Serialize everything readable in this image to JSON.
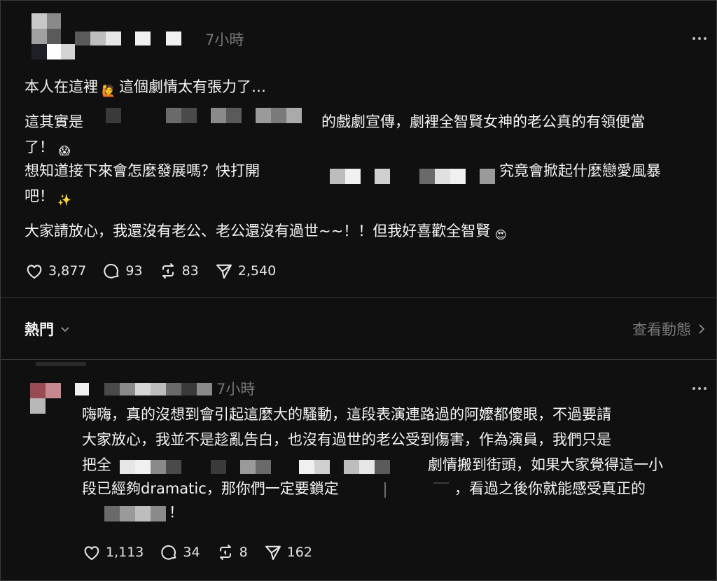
{
  "post": {
    "time": "7小時",
    "line1_text": "本人在這裡",
    "line1_text_b": "這個劇情太有張力了…",
    "line2_prefix": "這其實是",
    "line2_suffix": "的戲劇宣傳，劇裡全智賢女神的老公真的有領便當",
    "line3_text": "了！",
    "line4_prefix": "想知道接下來會怎麼發展嗎？快打開",
    "line4_suffix": "究竟會掀起什麼戀愛風暴",
    "line5_text": "吧！",
    "line6_text": "大家請放心，我還沒有老公、老公還沒有過世~~！！但我好喜歡全智賢",
    "likes": "3,877",
    "comments": "93",
    "reposts": "83",
    "shares": "2,540",
    "emoji_raise_hand": "🙋",
    "emoji_scream": "😱",
    "emoji_sparkles": "✨",
    "emoji_heart_eyes": "😍"
  },
  "tabs": {
    "sort_label": "熱門",
    "view_activity": "查看動態"
  },
  "reply": {
    "time": "7小時",
    "line1": "嗨嗨，真的沒想到會引起這麼大的騷動，這段表演連路過的阿嬤都傻眼，不過要請",
    "line2": "大家放心，我並不是趁亂告白，也沒有過世的老公受到傷害，作為演員，我們只是",
    "line3_prefix": "把全",
    "line3_suffix": "劇情搬到街頭，如果大家覺得這一小",
    "line4_prefix": "段已經夠dramatic，那你們一定要鎖定",
    "line4_suffix": "，看過之後你就能感受真正的",
    "line5_suffix": "！",
    "likes": "1,113",
    "comments": "34",
    "reposts": "8",
    "shares": "162"
  },
  "icons": {
    "like": "heart-icon",
    "comment": "comment-bubble-icon",
    "repost": "repost-icon",
    "share": "send-icon",
    "more": "more-dots-icon",
    "chevron": "chevron-down-icon",
    "chevron_right": "chevron-right-icon"
  },
  "colors": {
    "background": "#101010",
    "text": "#f3f5f7",
    "muted": "#777777",
    "divider": "#343434"
  }
}
